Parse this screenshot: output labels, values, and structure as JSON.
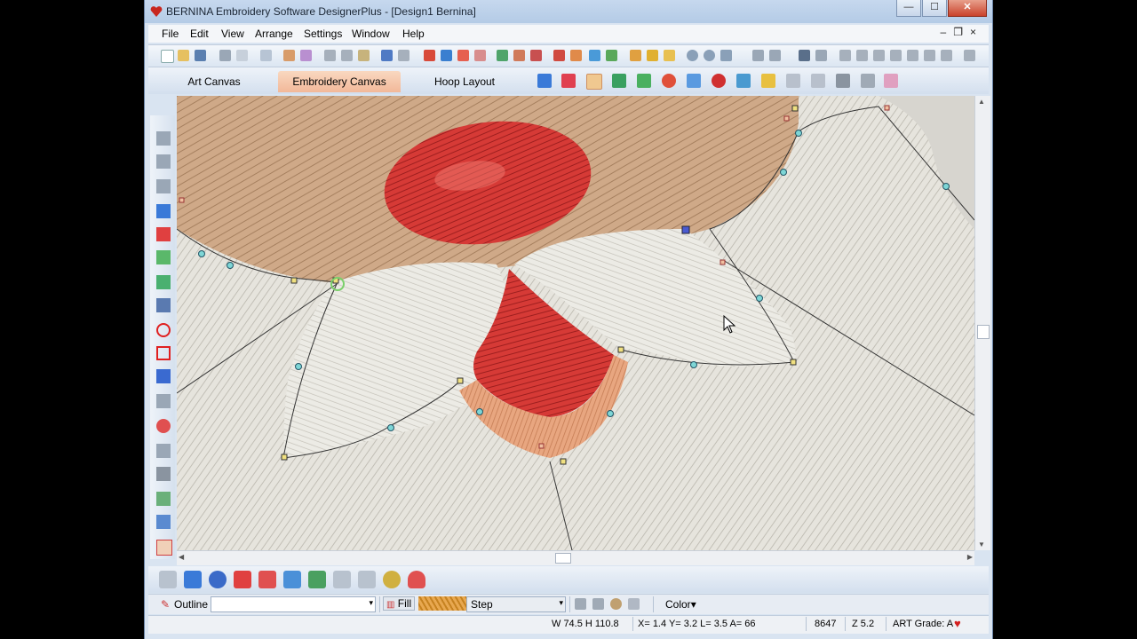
{
  "window": {
    "title": "BERNINA Embroidery Software DesignerPlus - [Design1        Bernina]",
    "buttons": {
      "minimize": "—",
      "maximize": "☐",
      "close": "✕"
    }
  },
  "menu": {
    "items": [
      "File",
      "Edit",
      "View",
      "Arrange",
      "Settings",
      "Window",
      "Help"
    ],
    "mdi_controls": "–❐×"
  },
  "tabs": {
    "items": [
      "Art Canvas",
      "Embroidery Canvas",
      "Hoop Layout"
    ],
    "active": "Embroidery Canvas"
  },
  "properties": {
    "outline_label": "Outline",
    "outline_value": "",
    "fill_label": "Fill",
    "fill_value": "Step",
    "color_label": "Color"
  },
  "status": {
    "size": "W  74.5 H 110.8",
    "coords": "X=   1.4 Y=   3.2 L=   3.5 A=  66",
    "stitches": "8647",
    "zoom": "Z 5.2",
    "grade": "ART Grade: A"
  },
  "colors": {
    "accent_tab": "#f2b899",
    "thread_red": "#d63a36",
    "thread_tan": "#c9a07c",
    "thread_white": "#e6e4dd",
    "thread_peach": "#e6a27c"
  }
}
